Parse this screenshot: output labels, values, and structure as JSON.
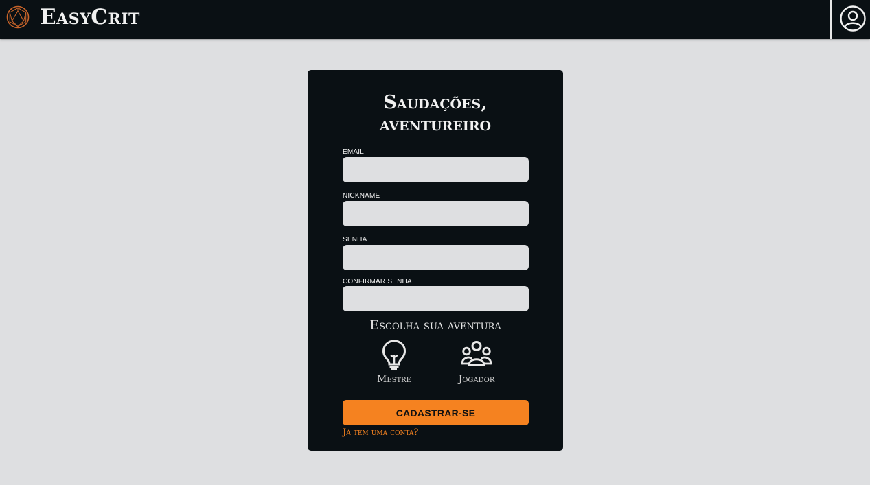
{
  "header": {
    "brand": "EasyCrit",
    "logo_icon": "d20-icon",
    "account_icon": "user-circle-icon"
  },
  "form": {
    "title_line1": "Saudações,",
    "title_line2": "aventureiro",
    "fields": [
      {
        "label": "EMAIL",
        "value": "",
        "placeholder": ""
      },
      {
        "label": "NICKNAME",
        "value": "",
        "placeholder": ""
      },
      {
        "label": "SENHA",
        "value": "",
        "placeholder": ""
      },
      {
        "label": "CONFIRMAR SENHA",
        "value": "",
        "placeholder": ""
      }
    ],
    "choose_label": "Escolha sua aventura",
    "roles": [
      {
        "label": "Mestre",
        "icon": "lightbulb-icon"
      },
      {
        "label": "Jogador",
        "icon": "group-icon"
      }
    ],
    "submit_label": "CADASTRAR-SE",
    "login_link": "Já tem uma conta?"
  },
  "colors": {
    "background": "#dedfe1",
    "panel": "#0a1014",
    "accent": "#f58220"
  }
}
